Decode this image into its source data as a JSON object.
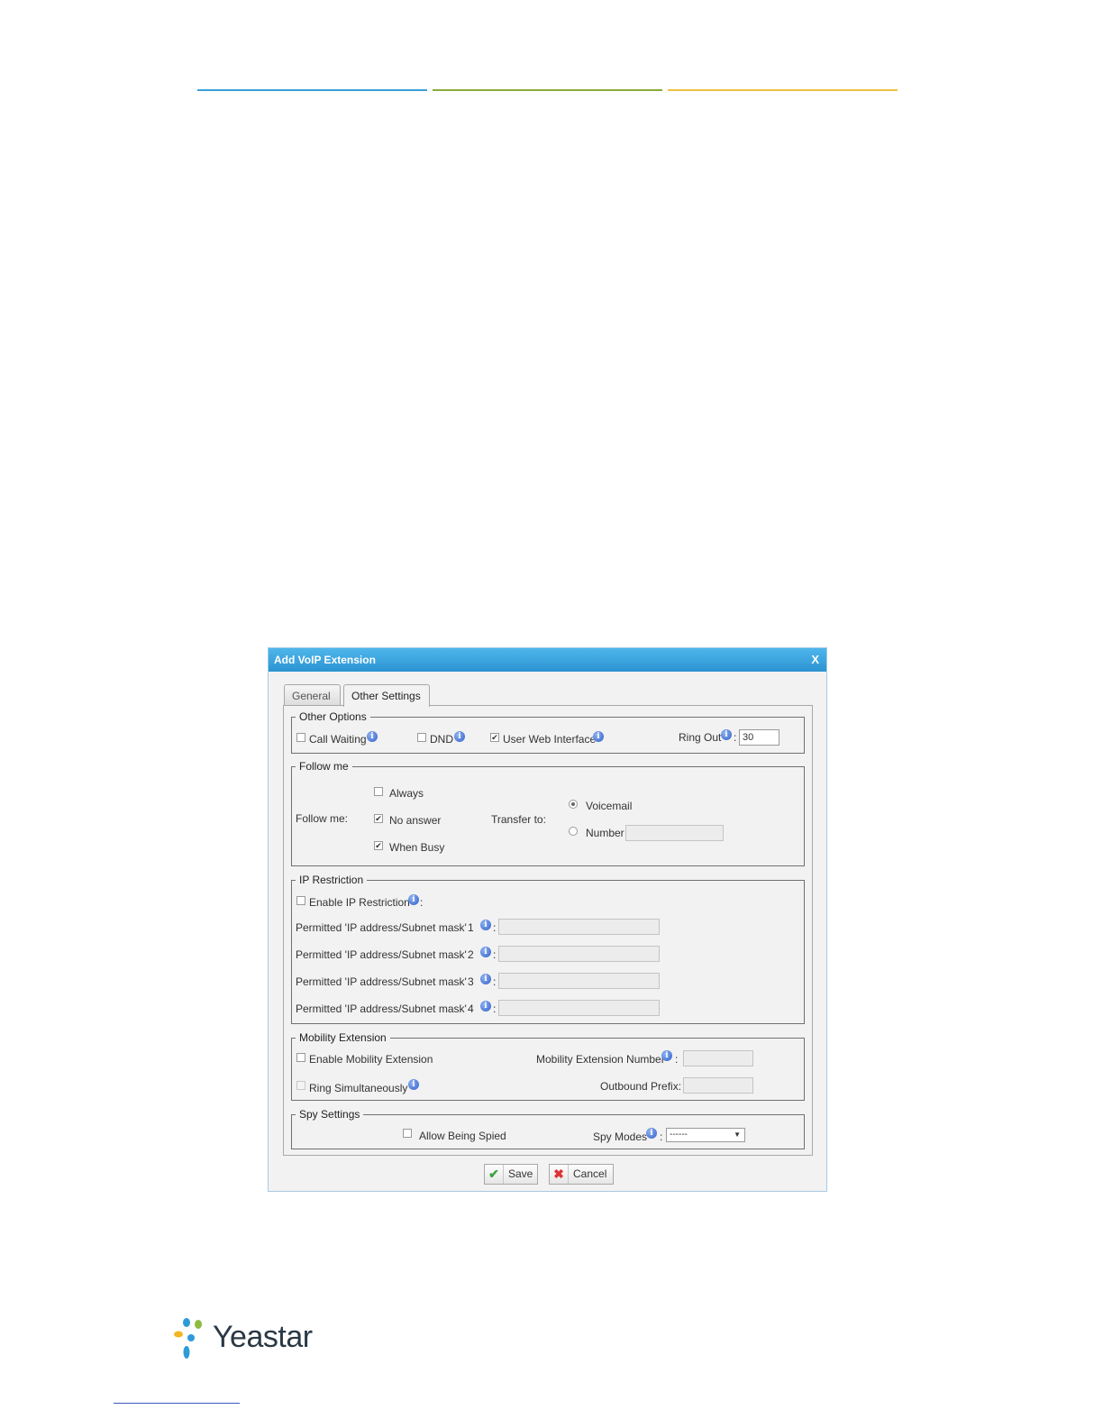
{
  "dialog": {
    "title": "Add VoIP Extension",
    "close_label": "X",
    "tabs": [
      "General",
      "Other Settings"
    ],
    "active_tab": "Other Settings"
  },
  "other_options": {
    "legend": "Other Options",
    "call_waiting": {
      "label": "Call Waiting",
      "checked": false
    },
    "dnd": {
      "label": "DND",
      "checked": false
    },
    "user_web_interface": {
      "label": "User Web Interface",
      "checked": true
    },
    "ring_out": {
      "label": "Ring Out",
      "value": "30"
    }
  },
  "follow_me": {
    "legend": "Follow me",
    "label": "Follow me:",
    "always": {
      "label": "Always",
      "checked": false
    },
    "no_answer": {
      "label": "No answer",
      "checked": true
    },
    "when_busy": {
      "label": "When Busy",
      "checked": true
    },
    "transfer_to_label": "Transfer to:",
    "voicemail": {
      "label": "Voicemail",
      "selected": true
    },
    "number": {
      "label": "Number",
      "selected": false,
      "value": ""
    }
  },
  "ip_restriction": {
    "legend": "IP Restriction",
    "enable": {
      "label": "Enable IP Restriction",
      "checked": false
    },
    "rows": [
      {
        "label": "Permitted 'IP address/Subnet mask'",
        "index": "1",
        "value": ""
      },
      {
        "label": "Permitted 'IP address/Subnet mask'",
        "index": "2",
        "value": ""
      },
      {
        "label": "Permitted 'IP address/Subnet mask'",
        "index": "3",
        "value": ""
      },
      {
        "label": "Permitted 'IP address/Subnet mask'",
        "index": "4",
        "value": ""
      }
    ]
  },
  "mobility_extension": {
    "legend": "Mobility Extension",
    "enable": {
      "label": "Enable Mobility Extension",
      "checked": false
    },
    "ring_simultaneously": {
      "label": "Ring Simultaneously",
      "checked": false
    },
    "number_label": "Mobility Extension Number",
    "number_value": "",
    "outbound_prefix_label": "Outbound Prefix:",
    "outbound_prefix_value": ""
  },
  "spy_settings": {
    "legend": "Spy Settings",
    "allow_being_spied": {
      "label": "Allow Being Spied",
      "checked": false
    },
    "spy_modes_label": "Spy Modes",
    "spy_modes_value": "------"
  },
  "buttons": {
    "save": "Save",
    "cancel": "Cancel"
  },
  "footer": {
    "brand": "Yeastar"
  },
  "colors": {
    "titlebar": "#2b93d2",
    "line_blue": "#3aa0d8",
    "line_green": "#8caa3a",
    "line_yellow": "#f0c040"
  }
}
